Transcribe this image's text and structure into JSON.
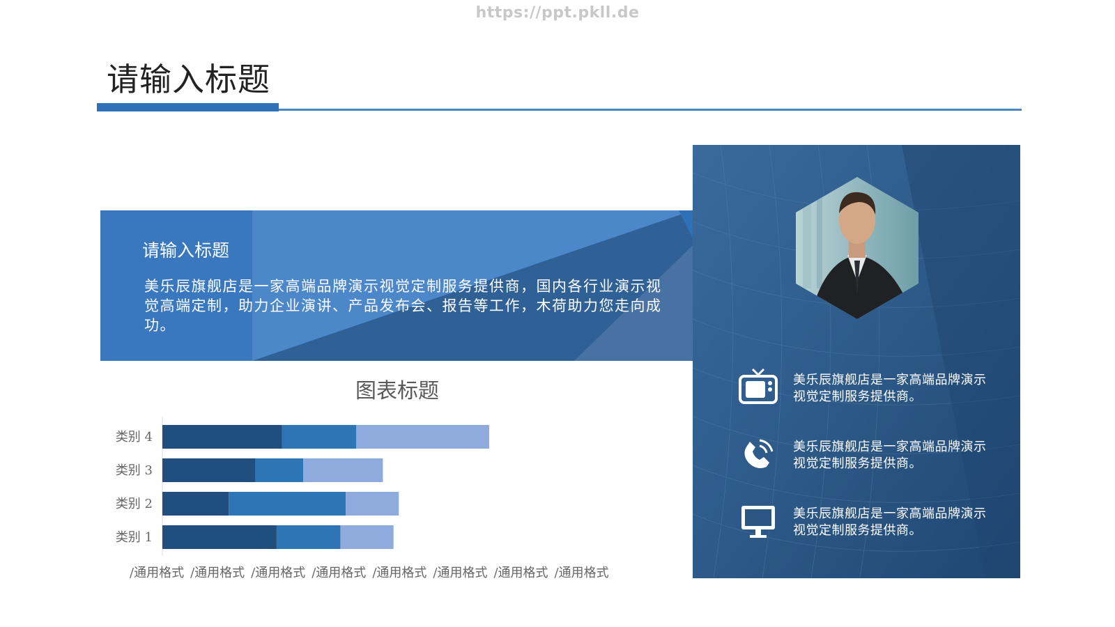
{
  "watermark": "https://ppt.pkll.de",
  "page_title": "请输入标题",
  "banner": {
    "title": "请输入标题",
    "body": "美乐辰旗舰店是一家高端品牌演示视觉定制服务提供商，国内各行业演示视觉高端定制，助力企业演讲、产品发布会、报告等工作，木荷助力您走向成功。"
  },
  "features": [
    {
      "icon": "tv-icon",
      "text": "美乐辰旗舰店是一家高端品牌演示视觉定制服务提供商。"
    },
    {
      "icon": "phone-icon",
      "text": "美乐辰旗舰店是一家高端品牌演示视觉定制服务提供商。"
    },
    {
      "icon": "monitor-icon",
      "text": "美乐辰旗舰店是一家高端品牌演示视觉定制服务提供商。"
    }
  ],
  "colors": {
    "accent": "#2e71b8",
    "panel": "#2b5583",
    "series_dark": "#1f4e7f",
    "series_mid": "#2e75b6",
    "series_light": "#8faadc"
  },
  "chart_data": {
    "type": "bar",
    "orientation": "horizontal",
    "stacked": true,
    "title": "图表标题",
    "categories": [
      "类别 4",
      "类别 3",
      "类别 2",
      "类别 1"
    ],
    "series": [
      {
        "values": [
          4.5,
          3.5,
          2.5,
          4.3
        ]
      },
      {
        "values": [
          2.8,
          1.8,
          4.4,
          2.4
        ]
      },
      {
        "values": [
          5.0,
          3.0,
          2.0,
          2.0
        ]
      }
    ],
    "xlim": [
      0,
      16
    ],
    "x_tick_labels": [
      "/通用格式",
      "/通用格式",
      "/通用格式",
      "/通用格式",
      "/通用格式",
      "/通用格式",
      "/通用格式",
      "/通用格式"
    ],
    "grid": false,
    "legend": "none"
  }
}
